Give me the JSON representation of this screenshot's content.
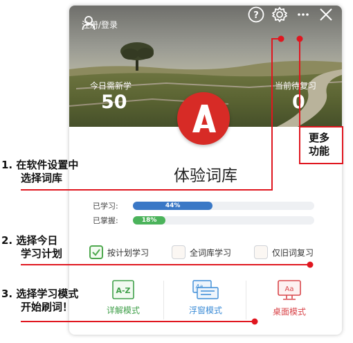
{
  "header": {
    "login_label": "注册/登录",
    "icons": [
      "user-icon",
      "help-icon",
      "gear-icon",
      "more-icon",
      "close-icon"
    ]
  },
  "stats": {
    "today_new_label": "今日需新学",
    "today_new_value": "50",
    "today_review_label": "当前待复习",
    "today_review_value": "0"
  },
  "library": {
    "name": "体验词库",
    "logo_letter": "A",
    "logo_color": "#d72b26"
  },
  "progress": {
    "learned_label": "已学习:",
    "learned_text": "44%",
    "learned_value": 0.44,
    "learned_color": "#3a78c6",
    "mastered_label": "已掌握:",
    "mastered_text": "18%",
    "mastered_value": 0.18,
    "mastered_color": "#4bb35b"
  },
  "learning_scope": {
    "options": [
      {
        "label": "按计划学习",
        "checked": true
      },
      {
        "label": "全词库学习",
        "checked": false
      },
      {
        "label": "仅旧词复习",
        "checked": false
      }
    ]
  },
  "study_modes": [
    {
      "label": "详解模式",
      "icon": "az-card-icon",
      "icon_text": "A-Z",
      "color": "#3f9f49"
    },
    {
      "label": "浮窗模式",
      "icon": "floating-window-icon",
      "icon_text": "Aa",
      "color": "#3a8bd6"
    },
    {
      "label": "桌面模式",
      "icon": "desktop-monitor-icon",
      "icon_text": "Aa",
      "color": "#d9454a"
    }
  ],
  "annotations": {
    "step1_line1": "1.  在软件设置中",
    "step1_line2": "选择词库",
    "step2_line1": "2.  选择今日",
    "step2_line2": "学习计划",
    "step3_line1": "3.  选择学习模式",
    "step3_line2": "开始刷词！",
    "more_line1": "更多",
    "more_line2": "功能",
    "accent_color": "#e0161f"
  }
}
